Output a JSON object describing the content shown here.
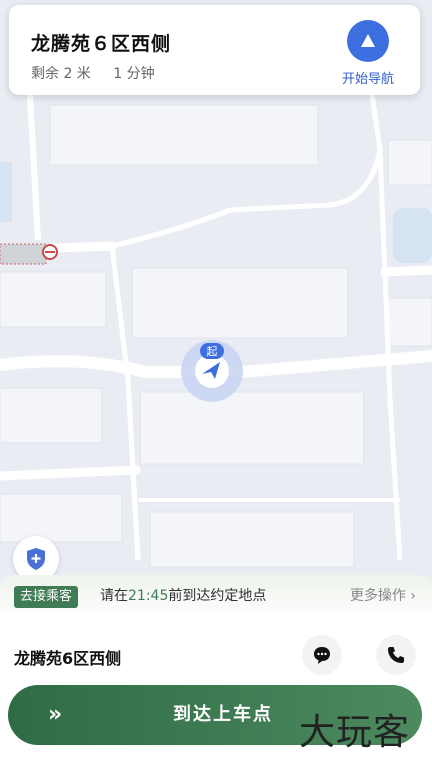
{
  "header": {
    "destination": "龙腾苑６区西侧",
    "remaining_distance": "剩余 2 米",
    "remaining_time": "1 分钟",
    "nav_label": "开始导航"
  },
  "map": {
    "start_marker_label": "起"
  },
  "status": {
    "badge": "去接乘客",
    "text_before": "请在",
    "time": "21:45",
    "text_after": "前到达约定地点",
    "more_label": "更多操作 ›"
  },
  "passenger": {
    "pickup_address": "龙腾苑6区西侧"
  },
  "slider": {
    "arrows": "»",
    "label": "到达上车点"
  },
  "watermark": "大玩客",
  "colors": {
    "accent_blue": "#3d6fe0",
    "accent_green": "#3f7b55"
  }
}
